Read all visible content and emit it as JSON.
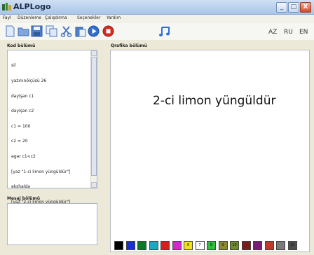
{
  "window": {
    "title": "ALPLogo",
    "minimize": "_",
    "maximize": "□",
    "close": "X"
  },
  "menu": [
    "Fayl",
    "Düzenleme",
    "Çalışdırma",
    "Seçenekler",
    "Yardım"
  ],
  "toolbar": {
    "icons": [
      "new-file-icon",
      "open-folder-icon",
      "save-icon",
      "copy-icon",
      "cut-icon",
      "paste-icon",
      "run-icon",
      "stop-icon",
      "music-note-icon"
    ],
    "languages": [
      "AZ",
      "RU",
      "EN"
    ]
  },
  "code_panel": {
    "label": "Kod bölümü",
    "lines": [
      "sil",
      "yazınınölçüsü 26",
      "dəyişən c1",
      "dəyişən c2",
      "c1 = 100",
      "c2 = 20",
      "əgər c1<c2",
      "[yaz \"1-ci limon yüngüldür\"]",
      "əkshalda",
      "[yaz \"2-ci limon yüngüldür\"]"
    ]
  },
  "message_panel": {
    "label": "Mesaj bölümü"
  },
  "graphics_panel": {
    "label": "Qrafika bölümü",
    "output_text": "2-ci limon yüngüldür"
  },
  "palette": [
    {
      "color": "#000000",
      "label": ""
    },
    {
      "color": "#1b2fd6",
      "label": ""
    },
    {
      "color": "#0a7a2a",
      "label": ""
    },
    {
      "color": "#18a9c6",
      "label": ""
    },
    {
      "color": "#e01b1b",
      "label": ""
    },
    {
      "color": "#d829c8",
      "label": ""
    },
    {
      "color": "#f2e21a",
      "label": "6"
    },
    {
      "color": "#ffffff",
      "label": "7"
    },
    {
      "color": "#2bc23a",
      "label": "8"
    },
    {
      "color": "#8a8a2a",
      "label": "9"
    },
    {
      "color": "#6e8c2a",
      "label": "10"
    },
    {
      "color": "#7a1d1d",
      "label": ""
    },
    {
      "color": "#7a1d7a",
      "label": ""
    },
    {
      "color": "#c0392b",
      "label": ""
    },
    {
      "color": "#7a7a7a",
      "label": ""
    },
    {
      "color": "#4d4d4d",
      "label": "15"
    }
  ]
}
